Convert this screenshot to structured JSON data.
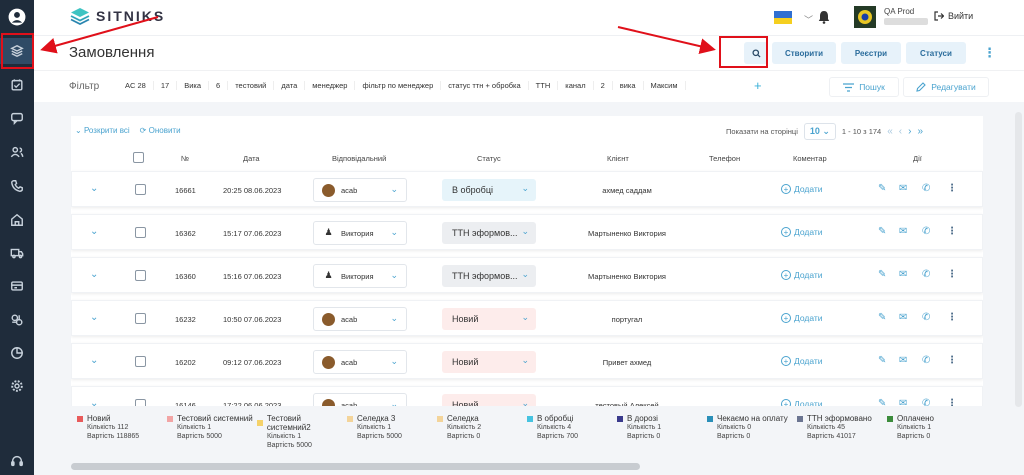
{
  "app": {
    "brand": "SITNIKS",
    "user_name": "QA Prod",
    "logout": "Вийти"
  },
  "page": {
    "title": "Замовлення"
  },
  "toolbar": {
    "create": "Створити",
    "registries": "Реєстри",
    "statuses": "Статуси"
  },
  "filter": {
    "label": "Фільтр",
    "chips": [
      "AC 28",
      "17",
      "Вика",
      "6",
      "тестовий",
      "дата",
      "менеджер",
      "фільтр по менеджер",
      "статус ттн + обробка",
      "ТТН",
      "канал",
      "2",
      "вика",
      "Максим"
    ],
    "search": "Пошук",
    "edit": "Редагувати"
  },
  "table_tools": {
    "expand_all": "Розкрити всі",
    "refresh": "Оновити",
    "show_per_page": "Показати на сторінці",
    "per_page": "10",
    "range": "1 - 10 з 174"
  },
  "columns": {
    "num": "№",
    "date": "Дата",
    "responsible": "Відповідальний",
    "status": "Статус",
    "client": "Клієнт",
    "phone": "Телефон",
    "comment": "Коментар",
    "actions": "Дії"
  },
  "add_label": "Додати",
  "rows": [
    {
      "num": "16661",
      "date": "20:25 08.06.2023",
      "resp": "acab",
      "avatar": "photo",
      "status": "В обробці",
      "status_color": "#e6f4fa",
      "client": "ахмед саддам"
    },
    {
      "num": "16362",
      "date": "15:17 07.06.2023",
      "resp": "Виктория",
      "avatar": "person",
      "status": "ТТН эформов...",
      "status_color": "#eceef1",
      "client": "Мартыненко Виктория"
    },
    {
      "num": "16360",
      "date": "15:16 07.06.2023",
      "resp": "Виктория",
      "avatar": "person",
      "status": "ТТН эформов...",
      "status_color": "#eceef1",
      "client": "Мартыненко Виктория"
    },
    {
      "num": "16232",
      "date": "10:50 07.06.2023",
      "resp": "acab",
      "avatar": "photo",
      "status": "Новий",
      "status_color": "#fdeceb",
      "client": "португал"
    },
    {
      "num": "16202",
      "date": "09:12 07.06.2023",
      "resp": "acab",
      "avatar": "photo",
      "status": "Новий",
      "status_color": "#fdeceb",
      "client": "Привет ахмед"
    },
    {
      "num": "16146",
      "date": "17:22 06.06.2023",
      "resp": "acab",
      "avatar": "photo",
      "status": "Новий",
      "status_color": "#fdeceb",
      "client": "тестовый Алексей"
    }
  ],
  "legend": [
    {
      "name": "Новий",
      "color": "#e85b5b",
      "count": "Кількість 112",
      "sum": "Вартість 118865"
    },
    {
      "name": "Тестовий системний",
      "color": "#f2a5a5",
      "count": "Кількість 1",
      "sum": "Вартість 5000"
    },
    {
      "name": "Тестовий системний2",
      "color": "#f5d26a",
      "count": "Кількість 1",
      "sum": "Вартість 5000"
    },
    {
      "name": "Селедка 3",
      "color": "#f3d49a",
      "count": "Кількість 1",
      "sum": "Вартість 5000"
    },
    {
      "name": "Селедка",
      "color": "#f3d49a",
      "count": "Кількість 2",
      "sum": "Вартість 0"
    },
    {
      "name": "В обробці",
      "color": "#46c3e0",
      "count": "Кількість 4",
      "sum": "Вартість 700"
    },
    {
      "name": "В дорозі",
      "color": "#3a3a8c",
      "count": "Кількість 1",
      "sum": "Вартість 0"
    },
    {
      "name": "Чекаємо на оплату",
      "color": "#2a8fb8",
      "count": "Кількість 0",
      "sum": "Вартість 0"
    },
    {
      "name": "ТТН эформовано",
      "color": "#6b7591",
      "count": "Кількість 45",
      "sum": "Вартість 41017"
    },
    {
      "name": "Оплачено",
      "color": "#3c8c3c",
      "count": "Кількість 1",
      "sum": "Вартість 0"
    }
  ]
}
